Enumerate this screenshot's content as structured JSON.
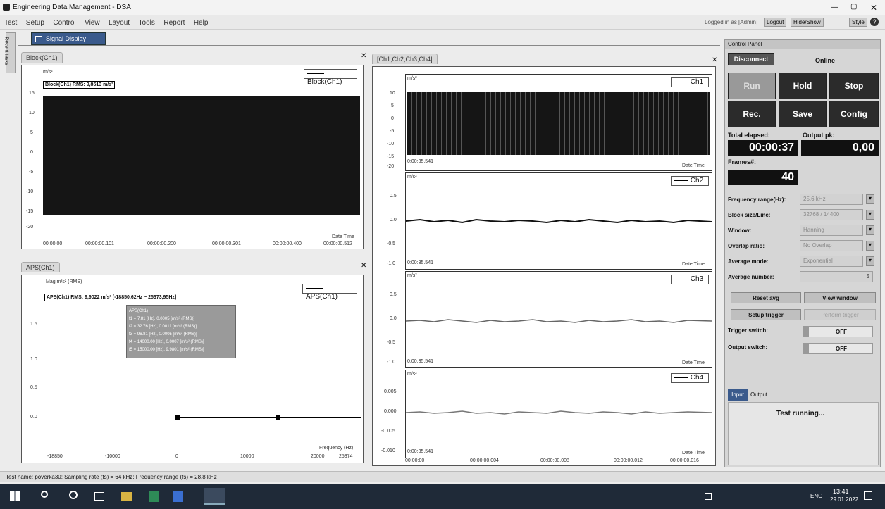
{
  "window": {
    "title": "Engineering Data Management - DSA",
    "controls": [
      "—",
      "▢",
      "✕"
    ]
  },
  "menu": [
    "Test",
    "Setup",
    "Control",
    "View",
    "Layout",
    "Tools",
    "Report",
    "Help"
  ],
  "login": {
    "status": "Logged in as [Admin]",
    "logout": "Logout",
    "hide_show": "Hide/Show",
    "style": "Style"
  },
  "side_tab": "Recent tasks",
  "doc_tab": "Signal Display",
  "panels": {
    "block": {
      "tab": "Block(Ch1)",
      "unit": "m/s²",
      "legend": "Block(Ch1)",
      "rms": "Block(Ch1) RMS: 9,8513 m/s²",
      "xlabel": "Date Time",
      "yticks": [
        "15",
        "10",
        "5",
        "0",
        "-5",
        "-10",
        "-15",
        "-20"
      ],
      "xticks": [
        "00:00:00",
        "00:00:00.101",
        "00:00:00.200",
        "00:00:00.301",
        "00:00:00.400",
        "00:00:00.512"
      ]
    },
    "aps": {
      "tab": "APS(Ch1)",
      "unit": "Mag m/s² (RMS)",
      "legend": "APS(Ch1)",
      "rms": "APS(Ch1) RMS: 9,9022 m/s² [-18850,62Hz ~ 25373,95Hz]",
      "tooltip_title": "APS(Ch1)",
      "tooltip": [
        "f1 = 7.81 [Hz], 0.0005 [m/s² (RMS)]",
        "f2 = 32.76 [Hz], 0.0011 [m/s² (RMS)]",
        "f3 = 96.81 [Hz], 0.0005 [m/s² (RMS)]",
        "f4 = 14000.00 [Hz], 0.0007 [m/s² (RMS)]",
        "f5 = 15000.00 [Hz], 9.9801 [m/s² (RMS)]"
      ],
      "yticks": [
        "1.5",
        "1.0",
        "0.5",
        "0.0"
      ],
      "xticks": [
        "-18850",
        "-10000",
        "0",
        "10000",
        "20000",
        "25374"
      ],
      "xlabel": "Frequency (Hz)"
    },
    "multi": {
      "tab": "[Ch1,Ch2,Ch3,Ch4]",
      "unit": "m/s²",
      "channels": [
        {
          "name": "Ch1",
          "time": "0:00:35.541",
          "yticks": [
            "10",
            "5",
            "0",
            "-5",
            "-10",
            "-15",
            "-20"
          ]
        },
        {
          "name": "Ch2",
          "time": "0:00:35.541",
          "yticks": [
            "0.5",
            "0.0",
            "-0.5",
            "-1.0"
          ]
        },
        {
          "name": "Ch3",
          "time": "0:00:35.541",
          "yticks": [
            "0.5",
            "0.0",
            "-0.5",
            "-1.0"
          ]
        },
        {
          "name": "Ch4",
          "time": "0:00:35.541",
          "yticks": [
            "0.005",
            "0.000",
            "-0.005",
            "-0.010"
          ]
        }
      ],
      "xlabel": "Date Time",
      "xticks": [
        "00:00:00",
        "00:00:00.004",
        "00:00:00.008",
        "00:00:00.012",
        "00:00:00.016"
      ]
    }
  },
  "control": {
    "title": "Control Panel",
    "disconnect": "Disconnect",
    "online": "Online",
    "run": "Run",
    "hold": "Hold",
    "stop": "Stop",
    "rec": "Rec.",
    "save": "Save",
    "config": "Config",
    "total_elapsed_label": "Total elapsed:",
    "output_pk_label": "Output pk:",
    "total_elapsed": "00:00:37",
    "output_pk": "0,00",
    "frames_label": "Frames#:",
    "frames": "40",
    "settings": [
      {
        "label": "Frequency range(Hz):",
        "value": "25,6 kHz"
      },
      {
        "label": "Block size/Line:",
        "value": "32768 / 14400"
      },
      {
        "label": "Window:",
        "value": "Hanning"
      },
      {
        "label": "Overlap ratio:",
        "value": "No Overlap"
      },
      {
        "label": "Average mode:",
        "value": "Exponential"
      },
      {
        "label": "Average number:",
        "value": "5"
      }
    ],
    "reset_avg": "Reset avg",
    "view_window": "View window",
    "setup_trigger": "Setup trigger",
    "perform_trigger": "Perform trigger",
    "trigger_switch_label": "Trigger switch:",
    "trigger_switch": "OFF",
    "output_switch_label": "Output switch:",
    "output_switch": "OFF",
    "io_tabs": [
      "Input",
      "Output"
    ],
    "status": "Test running..."
  },
  "statusbar": "Test name: poverka30; Sampling rate (fs) = 64 kHz; Frequency range (fs) = 28,8 kHz",
  "taskbar": {
    "lang": "ENG",
    "time": "13:41",
    "date": "29.01.2022"
  },
  "colors": {
    "accent": "#2b2b2b",
    "plot_fill": "#151515",
    "tab_blue": "#3a5a8c"
  }
}
